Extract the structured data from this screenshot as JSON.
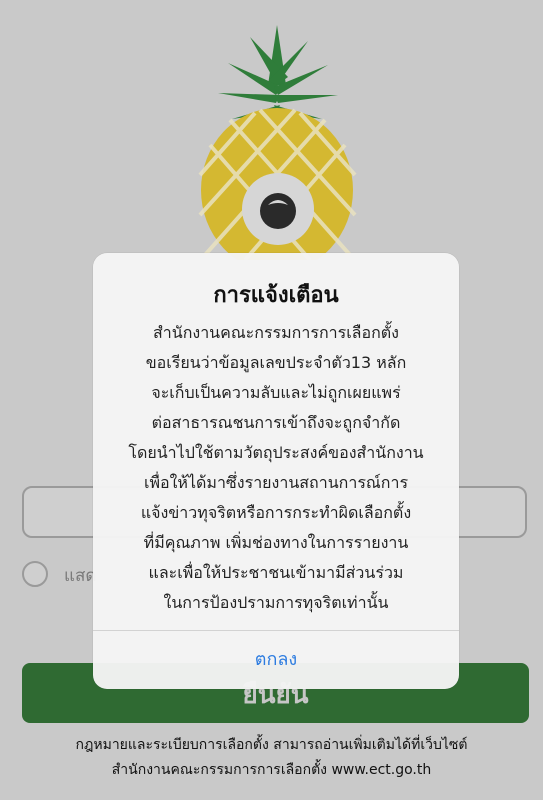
{
  "form": {
    "id_input_placeholder": "",
    "show_label": "แสด",
    "confirm_label": "ยืนยัน"
  },
  "footer": {
    "line1": "กฎหมายและระเบียบการเลือกตั้ง สามารถอ่านเพิ่มเติมได้ที่เว็บไซต์",
    "line2": "สำนักงานคณะกรรมการการเลือกตั้ง www.ect.go.th"
  },
  "alert": {
    "title": "การแจ้งเตือน",
    "lines": [
      "สำนักงานคณะกรรมการการเลือกตั้ง",
      "ขอเรียนว่าข้อมูลเลขประจำตัว13 หลัก",
      "จะเก็บเป็นความลับและไม่ถูกเผยแพร่",
      "ต่อสาธารณชนการเข้าถึงจะถูกจำกัด",
      "โดยนำไปใช้ตามวัตถุประสงค์ของสำนักงาน",
      "เพื่อให้ได้มาซึ่งรายงานสถานการณ์การ",
      "แจ้งข่าวทุจริตหรือการกระทำผิดเลือกตั้ง",
      "ที่มีคุณภาพ เพิ่มช่องทางในการรายงาน",
      "และเพื่อให้ประชาชนเข้ามามีส่วนร่วม",
      "ในการป้องปรามการทุจริตเท่านั้น"
    ],
    "ok_label": "ตกลง"
  },
  "colors": {
    "confirm_green": "#2f6a32",
    "ok_blue": "#2d7ce0",
    "pineapple_yellow": "#e3c63a",
    "leaf_green": "#2e8b3a"
  }
}
